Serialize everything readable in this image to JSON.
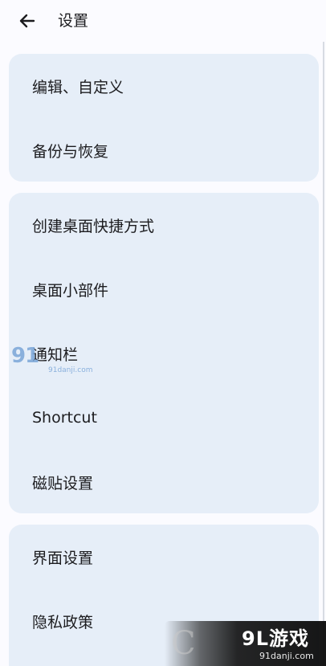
{
  "header": {
    "title": "设置",
    "back_icon": "arrow-left-icon"
  },
  "groups": [
    {
      "items": [
        {
          "label": "编辑、自定义"
        },
        {
          "label": "备份与恢复"
        }
      ]
    },
    {
      "items": [
        {
          "label": "创建桌面快捷方式"
        },
        {
          "label": "桌面小部件"
        },
        {
          "label": "通知栏"
        },
        {
          "label": "Shortcut"
        },
        {
          "label": "磁贴设置"
        }
      ]
    },
    {
      "items": [
        {
          "label": "界面设置"
        },
        {
          "label": "隐私政策"
        }
      ]
    }
  ],
  "watermarks": {
    "left_big": "91",
    "left_small": "91danji.com",
    "right_brand": "9L游戏",
    "right_domain": "91danji.com"
  },
  "colors": {
    "background": "#fbfbff",
    "card": "#e6eef8",
    "text": "#1c1c1f"
  }
}
